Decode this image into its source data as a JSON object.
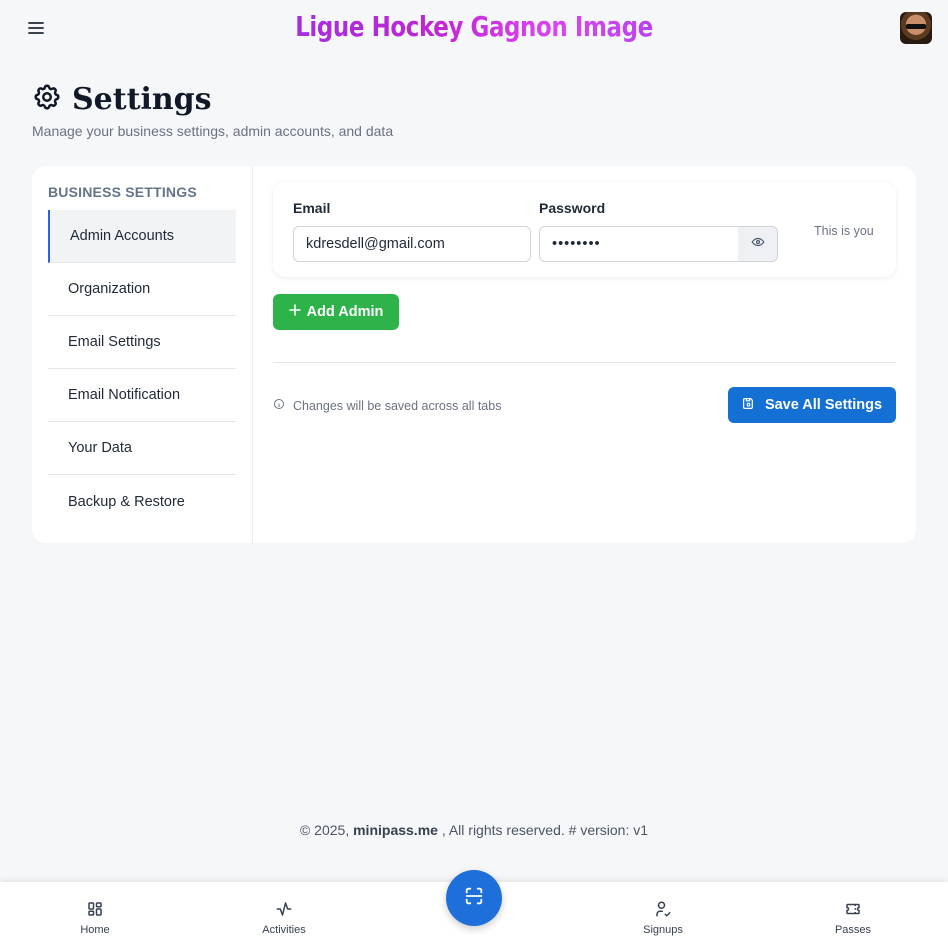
{
  "header": {
    "brand": "Ligue Hockey Gagnon Image",
    "menu_icon": "hamburger-menu-icon",
    "avatar_icon": "user-avatar"
  },
  "page": {
    "title": "Settings",
    "subtitle": "Manage your business settings, admin accounts, and data"
  },
  "sidebar": {
    "heading": "BUSINESS SETTINGS",
    "items": [
      {
        "label": "Admin Accounts",
        "active": true
      },
      {
        "label": "Organization"
      },
      {
        "label": "Email Settings"
      },
      {
        "label": "Email Notification"
      },
      {
        "label": "Your Data"
      },
      {
        "label": "Backup & Restore"
      }
    ]
  },
  "admin": {
    "email_label": "Email",
    "email_value": "kdresdell@gmail.com",
    "password_label": "Password",
    "password_value": "••••••••",
    "you_label": "This is you"
  },
  "actions": {
    "add_admin": "Add Admin",
    "note": "Changes will be saved across all tabs",
    "save": "Save All Settings"
  },
  "footer": {
    "prefix": "© 2025,",
    "brand": "minipass.me",
    "suffix": ", All rights reserved. # version: v1"
  },
  "bottom_nav": {
    "items": [
      {
        "label": "Home"
      },
      {
        "label": "Activities"
      },
      {
        "label": "Signups"
      },
      {
        "label": "Passes"
      }
    ]
  },
  "colors": {
    "primary": "#1570d6",
    "success": "#2eb34a",
    "brand_gradient_start": "#7c3aed",
    "brand_gradient_mid": "#d946ef"
  }
}
